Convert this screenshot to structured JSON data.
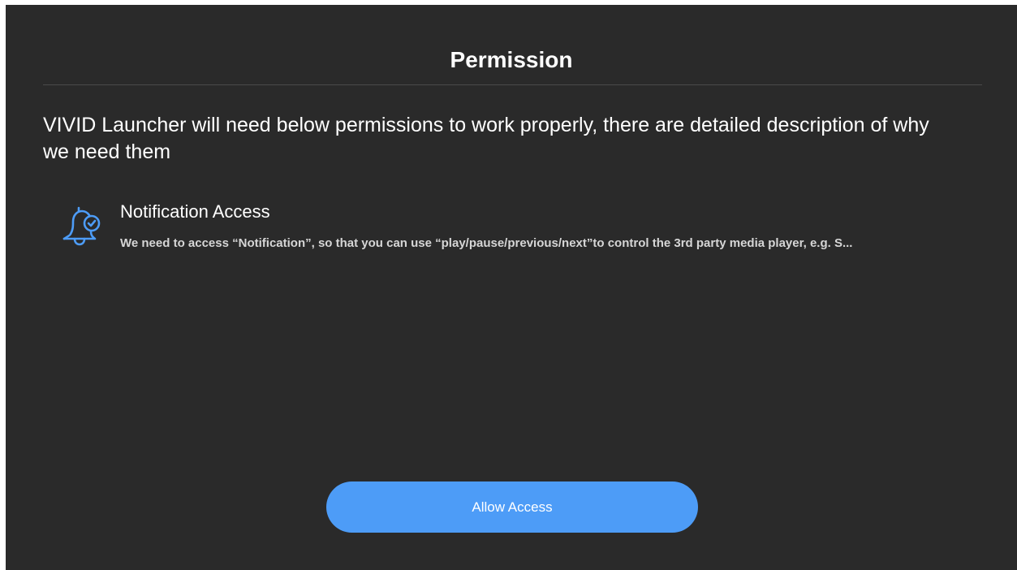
{
  "dialog": {
    "title": "Permission",
    "intro": "VIVID Launcher will need below permissions to work properly, there are detailed description of why we need them"
  },
  "permissions": [
    {
      "icon": "bell-check-icon",
      "title": "Notification Access",
      "description": "We need to access “Notification”, so that you can use “play/pause/previous/next”to control the 3rd party media player, e.g. S..."
    }
  ],
  "actions": {
    "allow_label": "Allow Access"
  },
  "colors": {
    "background": "#2a2a2a",
    "accent": "#4d9cf7",
    "icon": "#4d9cf7"
  }
}
